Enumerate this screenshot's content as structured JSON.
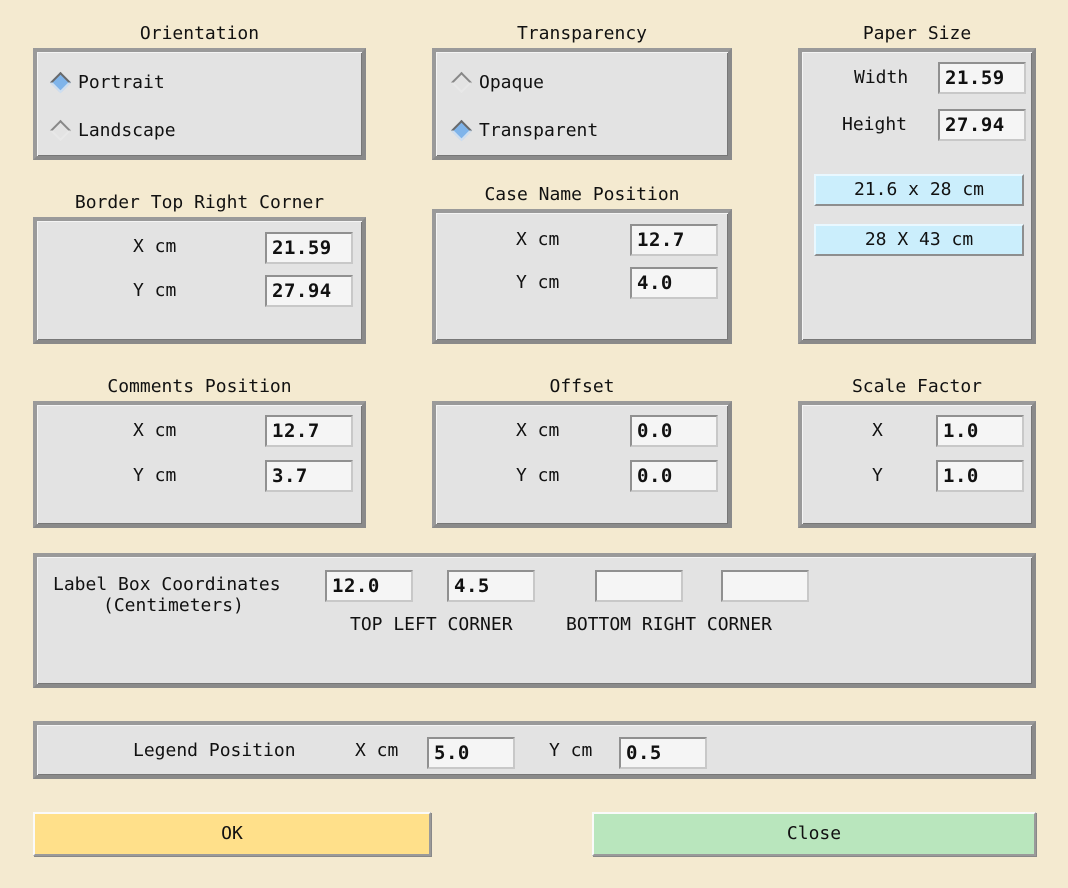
{
  "orientation": {
    "title": "Orientation",
    "options": [
      {
        "label": "Portrait",
        "selected": true
      },
      {
        "label": "Landscape",
        "selected": false
      }
    ]
  },
  "transparency": {
    "title": "Transparency",
    "options": [
      {
        "label": "Opaque",
        "selected": false
      },
      {
        "label": "Transparent",
        "selected": true
      }
    ]
  },
  "paper_size": {
    "title": "Paper Size",
    "width_label": "Width",
    "width_value": "21.59",
    "height_label": "Height",
    "height_value": "27.94",
    "presets": [
      "21.6 x 28 cm",
      "28 X 43 cm"
    ]
  },
  "border_top_right": {
    "title": "Border Top Right Corner",
    "x_label": "X cm",
    "x_value": "21.59",
    "y_label": "Y cm",
    "y_value": "27.94"
  },
  "case_name_position": {
    "title": "Case Name Position",
    "x_label": "X cm",
    "x_value": "12.7",
    "y_label": "Y cm",
    "y_value": "4.0"
  },
  "comments_position": {
    "title": "Comments Position",
    "x_label": "X cm",
    "x_value": "12.7",
    "y_label": "Y cm",
    "y_value": "3.7"
  },
  "offset": {
    "title": "Offset",
    "x_label": "X cm",
    "x_value": "0.0",
    "y_label": "Y cm",
    "y_value": "0.0"
  },
  "scale_factor": {
    "title": "Scale Factor",
    "x_label": "X",
    "x_value": "1.0",
    "y_label": "Y",
    "y_value": "1.0"
  },
  "label_box": {
    "label_line1": "Label Box Coordinates",
    "label_line2": "(Centimeters)",
    "top_left_x": "12.0",
    "top_left_y": "4.5",
    "bottom_right_x": "",
    "bottom_right_y": "",
    "top_left_caption": "TOP LEFT CORNER",
    "bottom_right_caption": "BOTTOM RIGHT CORNER"
  },
  "legend_position": {
    "label": "Legend Position",
    "x_label": "X cm",
    "x_value": "5.0",
    "y_label": "Y cm",
    "y_value": "0.5"
  },
  "buttons": {
    "ok": "OK",
    "close": "Close"
  },
  "colors": {
    "background": "#f4ead0",
    "panel": "#e3e3e3",
    "radio_selected": "#7fb4ea",
    "preset_button": "#cbeefc",
    "ok_button": "#ffe08a",
    "close_button": "#b9e6bd"
  }
}
